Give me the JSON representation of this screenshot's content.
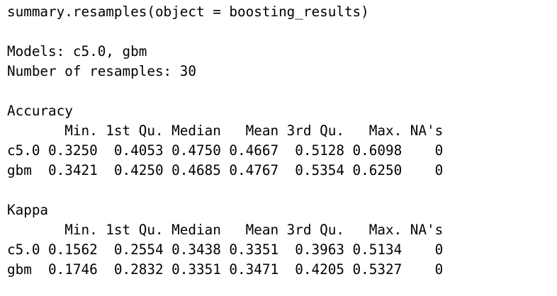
{
  "console": {
    "command": "summary.resamples(object = boosting_results)",
    "models_line": "Models: c5.0, gbm",
    "resamples_line": "Number of resamples: 30",
    "accuracy": {
      "title": "Accuracy",
      "header": "       Min. 1st Qu. Median   Mean 3rd Qu.   Max. NA's",
      "rows": [
        "c5.0 0.3250  0.4053 0.4750 0.4667  0.5128 0.6098    0",
        "gbm  0.3421  0.4250 0.4685 0.4767  0.5354 0.6250    0"
      ]
    },
    "kappa": {
      "title": "Kappa",
      "header": "       Min. 1st Qu. Median   Mean 3rd Qu.   Max. NA's",
      "rows": [
        "c5.0 0.1562  0.2554 0.3438 0.3351  0.3963 0.5134    0",
        "gbm  0.1746  0.2832 0.3351 0.3471  0.4205 0.5327    0"
      ]
    }
  }
}
